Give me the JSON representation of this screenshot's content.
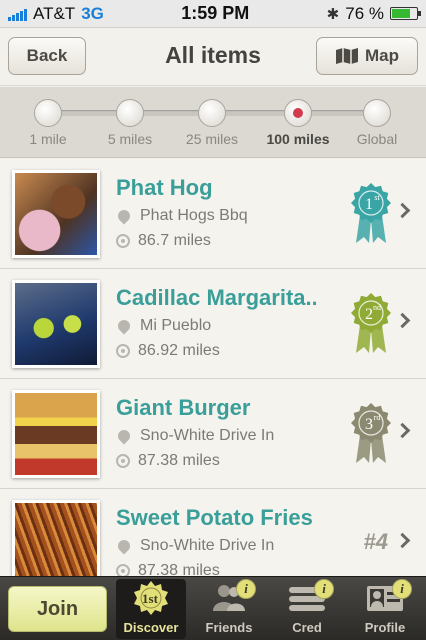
{
  "status_bar": {
    "carrier": "AT&T",
    "network": "3G",
    "time": "1:59 PM",
    "battery": "76 %",
    "battery_level": 0.76,
    "bluetooth_icon": "bluetooth-icon"
  },
  "nav": {
    "back_label": "Back",
    "title": "All items",
    "map_label": "Map",
    "map_icon": "map-icon"
  },
  "distance": {
    "stops": [
      "1 mile",
      "5 miles",
      "25 miles",
      "100 miles",
      "Global"
    ],
    "selected": "100 miles"
  },
  "items": [
    {
      "name": "Phat Hog",
      "place": "Phat Hogs Bbq",
      "distance": "86.7 miles",
      "rank_num": "1",
      "rank_sup": "st",
      "badge_color": "#3aa5a5"
    },
    {
      "name": "Cadillac Margarita...",
      "place": "Mi Pueblo",
      "distance": "86.92 miles",
      "rank_num": "2",
      "rank_sup": "nd",
      "badge_color": "#8faa35"
    },
    {
      "name": "Giant Burger",
      "place": "Sno-White Drive In",
      "distance": "87.38 miles",
      "rank_num": "3",
      "rank_sup": "rd",
      "badge_color": "#8b8a70"
    },
    {
      "name": "Sweet Potato Fries",
      "place": "Sno-White Drive In",
      "distance": "87.38 miles",
      "rank_text": "#4"
    }
  ],
  "tabbar": {
    "join_label": "Join",
    "tabs": [
      {
        "label": "Discover",
        "badge": "1st"
      },
      {
        "label": "Friends",
        "info": "i"
      },
      {
        "label": "Cred",
        "info": "i"
      },
      {
        "label": "Profile",
        "info": "i"
      }
    ]
  }
}
